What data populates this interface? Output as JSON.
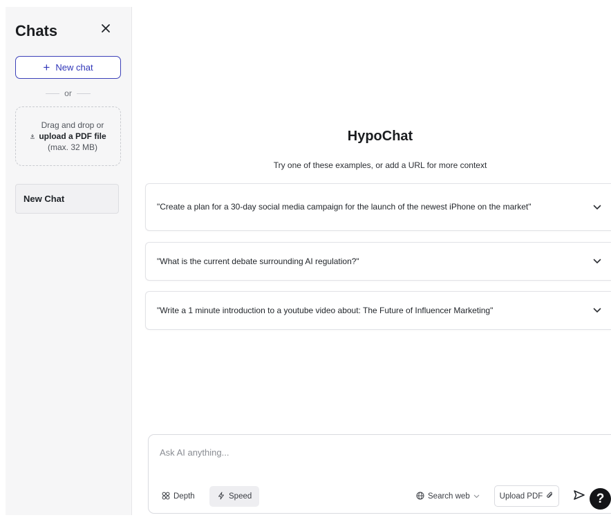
{
  "sidebar": {
    "title": "Chats",
    "close_icon": "close-icon",
    "new_chat_label": "New chat",
    "or_label": "or",
    "dropzone": {
      "line1": "Drag and drop or",
      "line2": "upload a PDF file",
      "line3": "(max. 32 MB)",
      "icon": "upload-icon"
    },
    "chats": [
      {
        "label": "New Chat"
      }
    ]
  },
  "main": {
    "title": "HypoChat",
    "subtitle": "Try one of these examples, or add a URL for more context",
    "examples": [
      {
        "text": "\"Create a plan for a 30-day social media campaign for the launch of the newest iPhone on the market\""
      },
      {
        "text": "\"What is the current debate surrounding AI regulation?\""
      },
      {
        "text": "\"Write a 1 minute introduction to a youtube video about: The Future of Influencer Marketing\""
      }
    ]
  },
  "composer": {
    "placeholder": "Ask AI anything...",
    "value": "",
    "depth_label": "Depth",
    "speed_label": "Speed",
    "search_web_label": "Search web",
    "upload_pdf_label": "Upload PDF",
    "selected_mode": "Speed"
  },
  "help_label": "?",
  "colors": {
    "accent": "#2f35b8",
    "sidebar_bg": "#f6f6f7",
    "help_bg": "#141518"
  }
}
